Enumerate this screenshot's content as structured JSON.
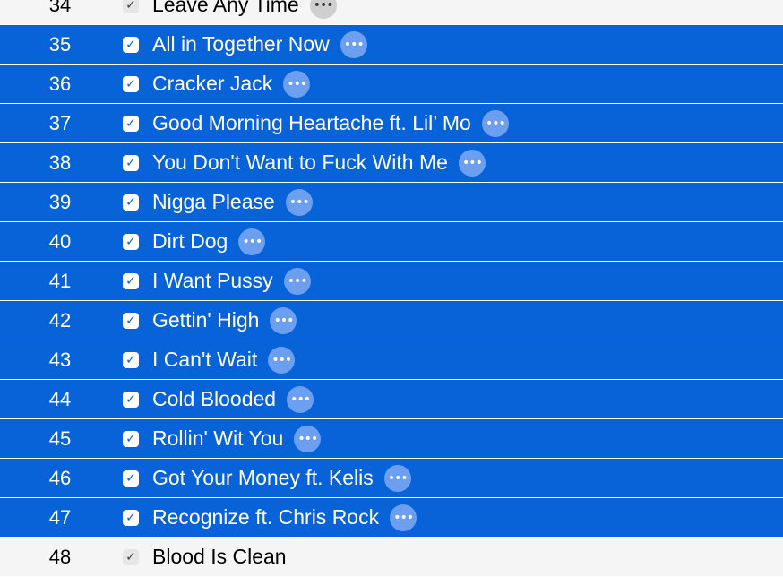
{
  "colors": {
    "selection": "#0862d8",
    "row_background": "#f5f5f5",
    "more_button_selected": "#6c9ff0"
  },
  "tracks": [
    {
      "number": "34",
      "title": "Leave Any Time",
      "checked": true,
      "selected": false
    },
    {
      "number": "35",
      "title": "All in Together Now",
      "checked": true,
      "selected": true
    },
    {
      "number": "36",
      "title": "Cracker Jack",
      "checked": true,
      "selected": true
    },
    {
      "number": "37",
      "title": "Good Morning Heartache ft. Lil’ Mo",
      "checked": true,
      "selected": true
    },
    {
      "number": "38",
      "title": "You Don't Want to Fuck With Me",
      "checked": true,
      "selected": true
    },
    {
      "number": "39",
      "title": "Nigga Please",
      "checked": true,
      "selected": true
    },
    {
      "number": "40",
      "title": "Dirt Dog",
      "checked": true,
      "selected": true
    },
    {
      "number": "41",
      "title": "I Want Pussy",
      "checked": true,
      "selected": true
    },
    {
      "number": "42",
      "title": "Gettin' High",
      "checked": true,
      "selected": true
    },
    {
      "number": "43",
      "title": "I Can't Wait",
      "checked": true,
      "selected": true
    },
    {
      "number": "44",
      "title": "Cold Blooded",
      "checked": true,
      "selected": true
    },
    {
      "number": "45",
      "title": "Rollin' Wit You",
      "checked": true,
      "selected": true
    },
    {
      "number": "46",
      "title": "Got Your Money ft. Kelis",
      "checked": true,
      "selected": true
    },
    {
      "number": "47",
      "title": "Recognize ft. Chris Rock",
      "checked": true,
      "selected": true
    },
    {
      "number": "48",
      "title": "Blood Is Clean",
      "checked": true,
      "selected": false
    }
  ]
}
